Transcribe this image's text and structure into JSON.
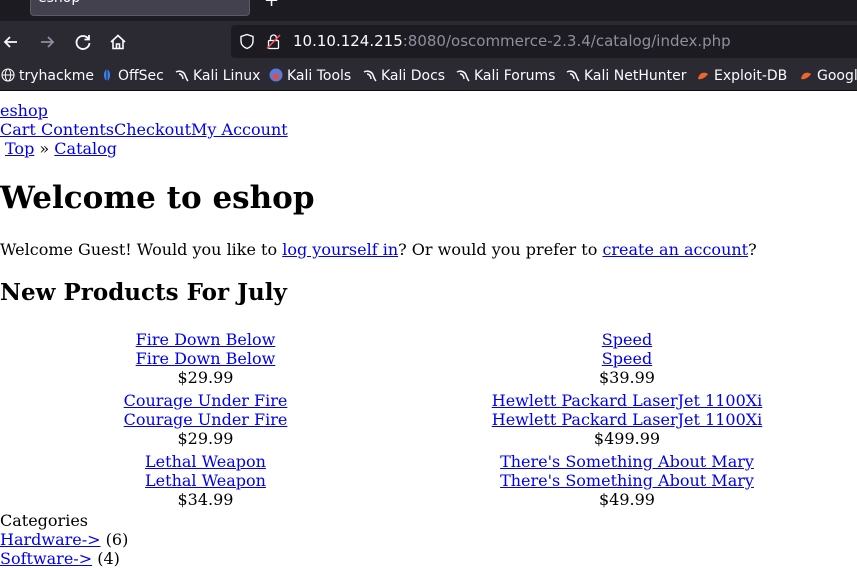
{
  "browser": {
    "tab_title": "eshop",
    "url_host": "10.10.124.215",
    "url_rest": ":8080/oscommerce-2.3.4/catalog/index.php",
    "bookmarks": [
      {
        "label": "tryhackme",
        "icon": "globe-icon"
      },
      {
        "label": "OffSec",
        "icon": "offsec-icon"
      },
      {
        "label": "Kali Linux",
        "icon": "kali-icon"
      },
      {
        "label": "Kali Tools",
        "icon": "kali-tools-icon"
      },
      {
        "label": "Kali Docs",
        "icon": "kali-icon"
      },
      {
        "label": "Kali Forums",
        "icon": "kali-icon"
      },
      {
        "label": "Kali NetHunter",
        "icon": "kali-icon"
      },
      {
        "label": "Exploit-DB",
        "icon": "exploitdb-icon"
      },
      {
        "label": "Googl",
        "icon": "ghdb-icon"
      }
    ]
  },
  "site": {
    "name": "eshop",
    "nav": {
      "cart": "Cart Contents",
      "checkout": "Checkout",
      "account": "My Account"
    },
    "breadcrumb": {
      "top": "Top",
      "sep": "»",
      "catalog": "Catalog"
    }
  },
  "main": {
    "heading": "Welcome to eshop",
    "welcome": {
      "pre": "Welcome Guest! Would you like to ",
      "login_link": "log yourself in",
      "mid": "? Or would you prefer to ",
      "create_link": "create an account",
      "post": "?"
    },
    "new_products_title": "New Products For July",
    "products": [
      {
        "name": "Fire Down Below",
        "price": "$29.99"
      },
      {
        "name": "Speed",
        "price": "$39.99"
      },
      {
        "name": "Courage Under Fire",
        "price": "$29.99"
      },
      {
        "name": "Hewlett Packard LaserJet 1100Xi",
        "price": "$499.99"
      },
      {
        "name": "Lethal Weapon",
        "price": "$34.99"
      },
      {
        "name": "There's Something About Mary",
        "price": "$49.99"
      }
    ]
  },
  "categories": {
    "title": "Categories",
    "items": [
      {
        "label": "Hardware->",
        "count": "(6)"
      },
      {
        "label": "Software->",
        "count": "(4)"
      }
    ]
  }
}
